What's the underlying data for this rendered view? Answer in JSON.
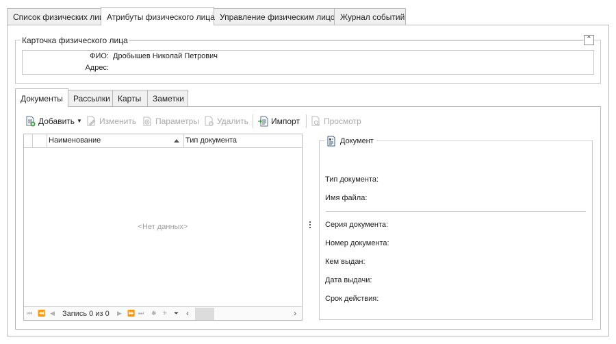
{
  "top_tabs": [
    {
      "label": "Список физических лиц"
    },
    {
      "label": "Атрибуты физического лица"
    },
    {
      "label": "Управление физическим лицом"
    },
    {
      "label": "Журнал событий"
    }
  ],
  "card": {
    "title": "Карточка физического лица",
    "collapse_glyph": "⌃",
    "fio_label": "ФИО:",
    "fio_value": "Дробышев Николай Петрович",
    "address_label": "Адрес:",
    "address_value": ""
  },
  "sub_tabs": [
    {
      "label": "Документы"
    },
    {
      "label": "Рассылки"
    },
    {
      "label": "Карты"
    },
    {
      "label": "Заметки"
    }
  ],
  "toolbar": {
    "add": "Добавить",
    "edit": "Изменить",
    "params": "Параметры",
    "delete": "Удалить",
    "import": "Импорт",
    "view": "Просмотр"
  },
  "grid": {
    "columns": [
      "Наименование",
      "Тип документа"
    ],
    "empty_text": "<Нет данных>",
    "nav_text": "Запись 0 из 0"
  },
  "document": {
    "title": "Документ",
    "fields": {
      "type": "Тип документа:",
      "filename": "Имя файла:",
      "series": "Серия документа:",
      "number": "Номер документа:",
      "issued_by": "Кем выдан:",
      "issue_date": "Дата выдачи:",
      "validity": "Срок действия:"
    }
  },
  "colors": {
    "border": "#b8b8b8",
    "disabled_text": "#a8a8a8",
    "tab_inactive": "#f0f0f0"
  }
}
